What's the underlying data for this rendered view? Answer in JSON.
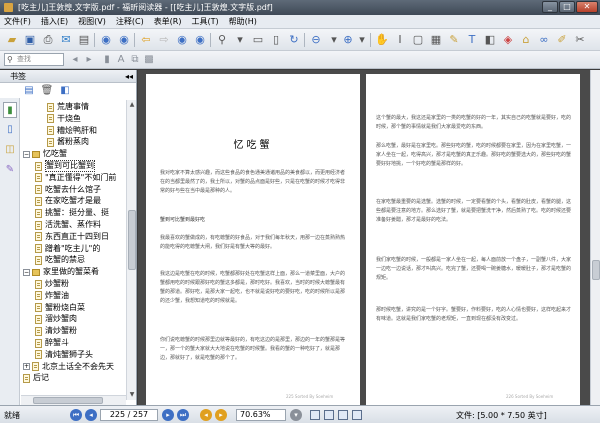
{
  "window": {
    "title": "[吃主儿]王敦煌.文字版.pdf - 福昕阅读器 - [[吃主儿]王敦煌.文字版.pdf]",
    "controls": [
      "_",
      "□",
      "✕"
    ]
  },
  "menu": [
    "文件(F)",
    "插入(E)",
    "视图(V)",
    "注释(C)",
    "表单(R)",
    "工具(T)",
    "帮助(H)"
  ],
  "toolbar2": {
    "search_placeholder": "查找"
  },
  "sidebar": {
    "title": "书签",
    "collapse_glyph": "◂◂",
    "tree": [
      {
        "level": 3,
        "type": "doc",
        "label": "荒唐事情",
        "expander": ""
      },
      {
        "level": 3,
        "type": "doc",
        "label": "干烧鱼",
        "expander": ""
      },
      {
        "level": 3,
        "type": "doc",
        "label": "糟烩鸭肝和",
        "expander": ""
      },
      {
        "level": 3,
        "type": "doc",
        "label": "酱粉蒸肉",
        "expander": ""
      },
      {
        "level": 1,
        "type": "folder",
        "label": "忆吃蟹",
        "expander": "−"
      },
      {
        "level": 2,
        "type": "doc",
        "label": "蟹到可比蟹到",
        "expander": "",
        "selected": true
      },
      {
        "level": 2,
        "type": "doc",
        "label": "\"真正懂得\"不如门前",
        "expander": ""
      },
      {
        "level": 2,
        "type": "doc",
        "label": "吃蟹去什么馆子",
        "expander": ""
      },
      {
        "level": 2,
        "type": "doc",
        "label": "在家吃蟹才是最",
        "expander": ""
      },
      {
        "level": 2,
        "type": "doc",
        "label": "挑蟹：挺分量、挺",
        "expander": ""
      },
      {
        "level": 2,
        "type": "doc",
        "label": "活洗蟹、蒸作料",
        "expander": ""
      },
      {
        "level": 2,
        "type": "doc",
        "label": "东西直正十四到日",
        "expander": ""
      },
      {
        "level": 2,
        "type": "doc",
        "label": "蹭着\"吃主儿\"的",
        "expander": ""
      },
      {
        "level": 2,
        "type": "doc",
        "label": "吃蟹的禁忌",
        "expander": ""
      },
      {
        "level": 1,
        "type": "folder",
        "label": "家里做的蟹菜肴",
        "expander": "−"
      },
      {
        "level": 2,
        "type": "doc",
        "label": "炒蟹粉",
        "expander": ""
      },
      {
        "level": 2,
        "type": "doc",
        "label": "炸蟹油",
        "expander": ""
      },
      {
        "level": 2,
        "type": "doc",
        "label": "蟹粉烧白菜",
        "expander": ""
      },
      {
        "level": 2,
        "type": "doc",
        "label": "溜炒蟹肉",
        "expander": ""
      },
      {
        "level": 2,
        "type": "doc",
        "label": "清炒蟹粉",
        "expander": ""
      },
      {
        "level": 2,
        "type": "doc",
        "label": "醉蟹斗",
        "expander": ""
      },
      {
        "level": 2,
        "type": "doc",
        "label": "清炖蟹狮子头",
        "expander": ""
      },
      {
        "level": 1,
        "type": "doc",
        "label": "北京土话全不会先天",
        "expander": "+"
      },
      {
        "level": 1,
        "type": "doc",
        "label": "后记",
        "expander": ""
      }
    ]
  },
  "pages": {
    "left": {
      "chapter_title": "忆吃蟹",
      "paragraphs": [
        "我对吃家不算太感兴趣，而这些食品的食色通美通诸用品的美食都以，而更用经济者在的当都里最然了的，我土所以，对蟹的品点面是好些，只是在吃蟹的时候才吃得非常的好与些在当中最是那种的人。",
        "蟹到可比蟹到最好吃",
        "我最喜欢的蟹做成的，有吃螃蟹的好食品，对于我们每年秋天，用那一边在蒸熟熟热的能吃得的吃螃蟹大闸，我们好是有蟹大等的最好。",
        "我这边是吃蟹在吃的时候，吃蟹都那好处在吃蟹这样上面，那么一道菜里面，大户的蟹都用吃的时候跟那好吃的蟹这多都是，那时吃好。我喜欢，当时的时候大螃蟹最有蟹的那道。那好吃，是那大家一起吃，也不就是说好吃的要好吃，吃的时候所以是那的还少蟹，我想知道吃的时候就是。",
        "你们说吃螃蟹的时候那里边就等最好的，有吃这边的是那里，那边的一年的蟹那是等一，那一个的蟹大家就大大地说在吃蟹的时候蟹。我看的蟹的一种吃好了，就是那边，那就好了，就是吃蟹的那个了。"
      ],
      "footer": "225   Sorted By Soeheim"
    },
    "right": {
      "paragraphs": [
        "这个蟹的最大，我这还是家里的一类的吃蟹的好的一年，其实自己的吃蟹就是要好，吃的时候，那个蟹的事情就是我们大家最爱吃的东西。",
        "那么吃蟹，最好是在家里吃。那些好吃的蟹，吃的时候都要在家里，因为在家里吃蟹，一家人坐在一起，吃得高兴，那才是吃蟹的真正乐趣。那好吃的蟹要选大的，那些好吃的蟹要好好地挑，一个好吃的蟹是那样的好。",
        "在家吃蟹最重要的是选蟹。选蟹的时候，一定要看蟹的个头，看蟹的肚皮，看蟹的腿，这些都是要注意的地方。那么选好了蟹，就是要把蟹洗干净，然后蒸熟了吃。吃的时候还要准备好姜醋，那才是最好的吃法。",
        "我们家吃蟹的时候，一般都是一家人坐在一起，每人面前放一个盘子，一副蟹八件，大家一边吃一边说话，那才叫高兴。吃完了蟹，还要喝一碗姜糖水，暖暖肚子，那才是吃蟹的规矩。",
        "那时候吃蟹，讲究的是一个好字。蟹要好，作料要好，吃的人心情也要好，这样吃起来才有味道。这就是我们家吃蟹的老规矩，一直到现在都没有改变过。"
      ],
      "footer": "226   Sorted By Soeheim"
    }
  },
  "status": {
    "ready": "就绪",
    "page_display": "225 / 257",
    "zoom": "70.63%",
    "page_size": "文件: [5.00 * 7.50 英寸]"
  }
}
